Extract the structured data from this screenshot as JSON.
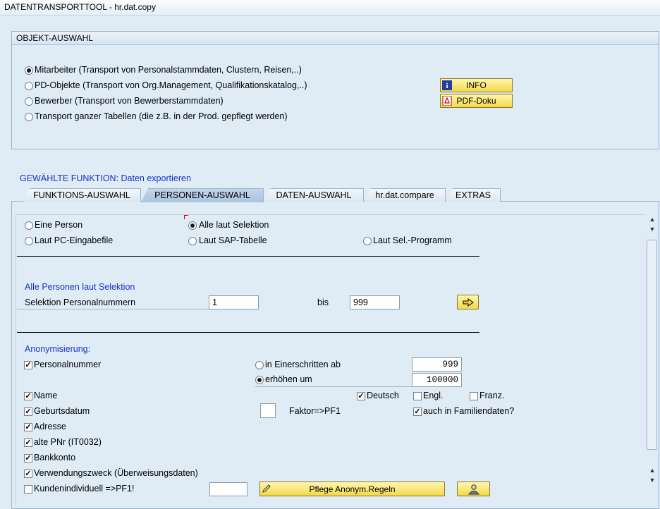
{
  "window": {
    "title": "DATENTRANSPORTTOOL - hr.dat.copy"
  },
  "objekt": {
    "title": "OBJEKT-AUSWAHL",
    "options": [
      {
        "label": "Mitarbeiter   (Transport von Personalstammdaten, Clustern, Reisen,..)",
        "selected": true
      },
      {
        "label": "PD-Objekte (Transport von Org.Management, Qualifikationskatalog,..)",
        "selected": false
      },
      {
        "label": "Bewerber    (Transport von Bewerberstammdaten)",
        "selected": false
      },
      {
        "label": "Transport ganzer Tabellen (die z.B. in der Prod. gepflegt werden)",
        "selected": false
      }
    ],
    "info_button": "INFO",
    "pdf_button": "PDF-Doku"
  },
  "function_title": "GEWÄHLTE FUNKTION: Daten exportieren",
  "tabs": [
    {
      "label": "FUNKTIONS-AUSWAHL",
      "active": false
    },
    {
      "label": "PERSONEN-AUSWAHL",
      "active": true
    },
    {
      "label": "DATEN-AUSWAHL",
      "active": false
    },
    {
      "label": "hr.dat.compare",
      "active": false
    },
    {
      "label": "EXTRAS",
      "active": false
    }
  ],
  "person": {
    "eine_person": "Eine Person",
    "alle_laut_selektion": "Alle laut Selektion",
    "laut_pc": "Laut PC-Eingabefile",
    "laut_sap": "Laut SAP-Tabelle",
    "laut_sel": "Laut Sel.-Programm",
    "selection_title": "Alle Personen laut Selektion",
    "sel_label": "Selektion Personalnummern",
    "from_value": "1",
    "to_label": "bis",
    "to_value": "999"
  },
  "anonym": {
    "title": "Anonymisierung:",
    "personalnummer": "Personalnummer",
    "einerschritten": "in Einerschritten ab",
    "einerschritten_value": "999",
    "erhoehen": "erhöhen um",
    "erhoehen_value": "100000",
    "name": "Name",
    "deutsch": "Deutsch",
    "engl": "Engl.",
    "franz": "Franz.",
    "geburtsdatum": "Geburtsdatum",
    "faktor": "Faktor=>PF1",
    "familiendaten": "auch in Familiendaten?",
    "adresse": "Adresse",
    "alte_pnr": "alte PNr (IT0032)",
    "bankkonto": "Bankkonto",
    "verwendungszweck": "Verwendungszweck (Überweisungsdaten)",
    "kundenindividuell": "Kundenindividuell =>PF1!",
    "pflege_button": "Pflege Anonym.Regeln"
  }
}
